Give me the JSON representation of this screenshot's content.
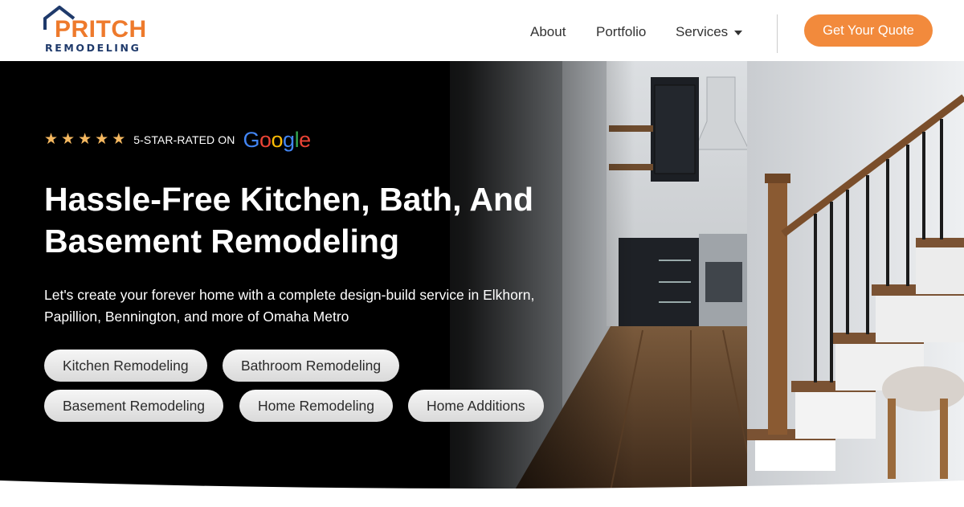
{
  "header": {
    "logo": {
      "word": "PRITCH",
      "sub": "REMODELING"
    },
    "nav": [
      {
        "label": "About"
      },
      {
        "label": "Portfolio"
      },
      {
        "label": "Services"
      }
    ],
    "cta_label": "Get Your Quote"
  },
  "hero": {
    "rating": {
      "stars": 5,
      "text": "5-STAR-RATED ON",
      "brand": "Google"
    },
    "headline_bold": "Hassle-Free",
    "headline_rest": " Kitchen, Bath, And Basement Remodeling",
    "intro": "Let's create your forever home with a complete design-build service in Elkhorn, Papillion, Bennington, and more of Omaha Metro",
    "services": [
      {
        "label": "Kitchen Remodeling"
      },
      {
        "label": "Bathroom Remodeling"
      },
      {
        "label": "Basement Remodeling"
      },
      {
        "label": "Home Remodeling"
      },
      {
        "label": "Home Additions"
      }
    ]
  },
  "colors": {
    "brand_orange": "#f28a3c",
    "brand_navy": "#1f3a6b",
    "star": "#f5b860"
  }
}
